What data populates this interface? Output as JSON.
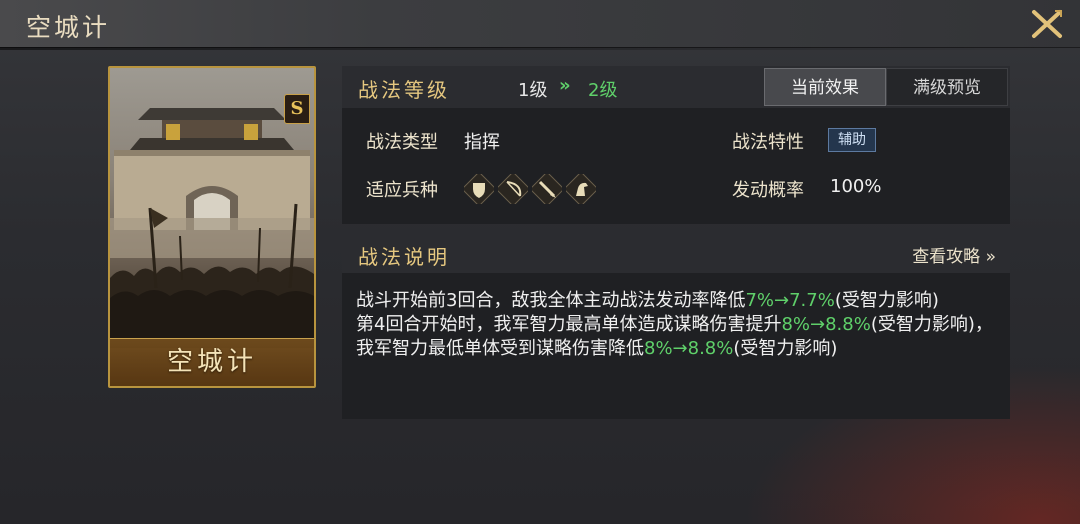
{
  "header": {
    "title": "空城计"
  },
  "card": {
    "name": "空城计",
    "rank": "S"
  },
  "level": {
    "section_title": "战法等级",
    "current": "1级",
    "arrow": "»",
    "next": "2级"
  },
  "tabs": [
    {
      "label": "当前效果",
      "active": true
    },
    {
      "label": "满级预览",
      "active": false
    }
  ],
  "info": {
    "type_label": "战法类型",
    "type_value": "指挥",
    "trait_label": "战法特性",
    "trait_value": "辅助",
    "units_label": "适应兵种",
    "units": [
      "shield-infantry-icon",
      "bow-archer-icon",
      "spear-icon",
      "horse-cavalry-icon"
    ],
    "rate_label": "发动概率",
    "rate_value": "100%"
  },
  "description": {
    "section_title": "战法说明",
    "guide_link": "查看攻略 »",
    "line1_a": "战斗开始前3回合，敌我全体主动战法发动率降低",
    "line1_hl": "7%→7.7%",
    "line1_b": "(受智力影响)",
    "line2_a": "第4回合开始时，我军智力最高单体造成谋略伤害提升",
    "line2_hl": "8%→8.8%",
    "line2_b": "(受智力影响)，我军智力最低单体受到谋略伤害降低",
    "line2_hl2": "8%→8.8%",
    "line2_c": "(受智力影响)"
  },
  "colors": {
    "accent_gold": "#e5c77f",
    "upgrade_green": "#5fd06a",
    "card_border": "#b8943e"
  }
}
